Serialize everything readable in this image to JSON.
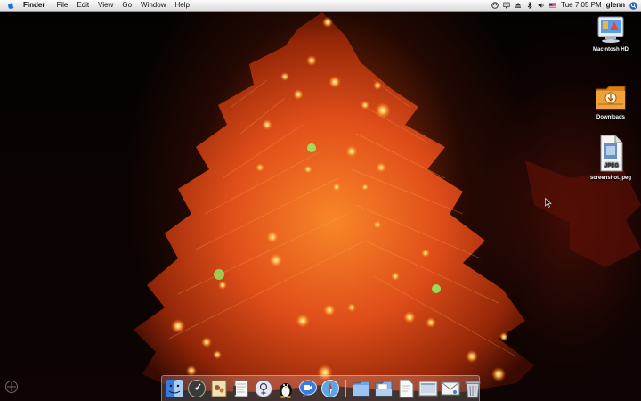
{
  "menubar": {
    "apple_icon": "apple-logo-icon",
    "app_name": "Finder",
    "menus": [
      "File",
      "Edit",
      "View",
      "Go",
      "Window",
      "Help"
    ],
    "extras": [
      "sync-icon",
      "displays-icon",
      "eject-icon",
      "bluetooth-icon",
      "volume-icon",
      "us-flag-icon"
    ],
    "clock": "Tue 7:05 PM",
    "user": "glenn",
    "spotlight_icon": "spotlight-icon"
  },
  "desktop_icons": [
    {
      "label": "Macintosh HD",
      "icon": "hard-drive-icon"
    },
    {
      "label": "Downloads",
      "icon": "downloads-folder-icon"
    },
    {
      "label": "screenshot.jpeg",
      "icon": "jpeg-file-icon",
      "badge": "JPEG"
    }
  ],
  "dock": {
    "apps": [
      "finder-icon",
      "dashboard-icon",
      "preview-icon",
      "textedit-icon",
      "itunes-icon",
      "linux-penguin-icon",
      "ichat-icon",
      "safari-icon"
    ],
    "documents": [
      "applications-folder-icon",
      "documents-folder-icon",
      "pdf-document-icon",
      "screenshot-icon",
      "mail-icon",
      "trash-icon"
    ]
  },
  "colors": {
    "menubar_bg": "#eeeeee",
    "light_orange": "#ff7a1c",
    "light_yellow": "#ffe58a",
    "light_green": "#7dff6a"
  }
}
